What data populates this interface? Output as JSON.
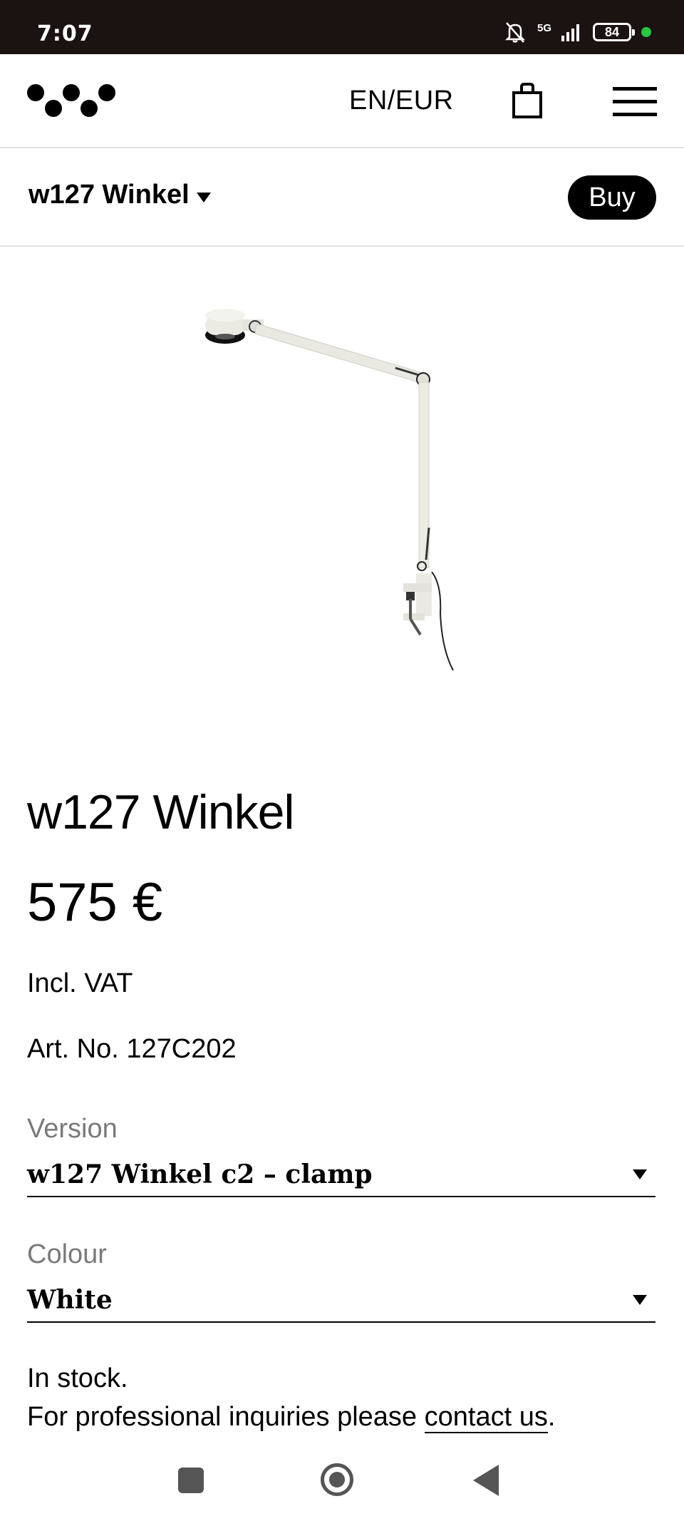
{
  "status_bar": {
    "time": "7:07",
    "network": "5G",
    "battery": "84"
  },
  "header": {
    "lang_currency": "EN/EUR"
  },
  "subbar": {
    "product_title": "w127 Winkel",
    "buy_label": "Buy"
  },
  "product": {
    "name": "w127 Winkel",
    "price": "575 €",
    "vat": "Incl. VAT",
    "art_no": "Art. No. 127C202"
  },
  "version": {
    "label": "Version",
    "selected": "w127 Winkel c2 – clamp"
  },
  "colour": {
    "label": "Colour",
    "selected": "White"
  },
  "stock": {
    "status": "In stock.",
    "inquiry_prefix": "For professional inquiries please ",
    "contact_link": "contact us",
    "inquiry_suffix": "."
  },
  "colors": {
    "status_bar_bg": "#1b1212",
    "accent": "#000000",
    "label_gray": "#7a7a7a",
    "online_dot": "#27c93f"
  }
}
